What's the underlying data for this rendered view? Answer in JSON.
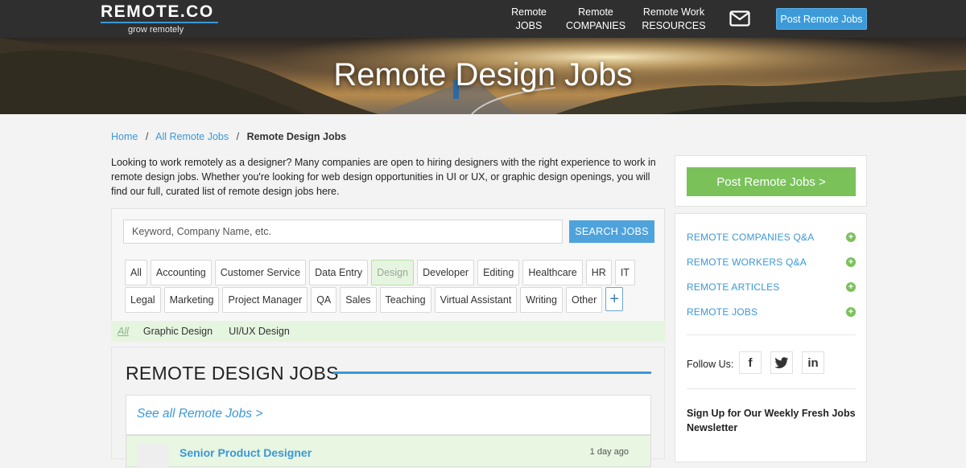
{
  "header": {
    "logo": "REMOTE.CO",
    "tagline": "grow remotely",
    "nav": [
      {
        "line1": "Remote",
        "line2": "JOBS"
      },
      {
        "line1": "Remote",
        "line2": "COMPANIES"
      },
      {
        "line1": "Remote Work",
        "line2": "RESOURCES"
      }
    ],
    "mail_icon": "mail-icon",
    "post_button": "Post Remote Jobs"
  },
  "hero": {
    "title": "Remote Design Jobs"
  },
  "breadcrumb": {
    "home": "Home",
    "sep1": "/",
    "all_jobs": "All Remote Jobs",
    "sep2": "/",
    "current": "Remote Design Jobs"
  },
  "intro": "Looking to work remotely as a designer? Many companies are open to hiring designers with the right experience to work in remote design jobs. Whether you're looking for web design opportunities in UI or UX, or graphic design openings, you will find our full, curated list of remote design jobs here.",
  "search": {
    "placeholder": "Keyword, Company Name, etc.",
    "button": "SEARCH JOBS"
  },
  "categories_row1": [
    "All",
    "Accounting",
    "Customer Service",
    "Data Entry",
    "Design",
    "Developer",
    "Editing",
    "Healthcare",
    "HR",
    "IT"
  ],
  "categories_row2": [
    "Legal",
    "Marketing",
    "Project Manager",
    "QA",
    "Sales",
    "Teaching",
    "Virtual Assistant",
    "Writing",
    "Other"
  ],
  "active_category": "Design",
  "more_button": "+",
  "subcategories": {
    "all": "All",
    "items": [
      "Graphic Design",
      "UI/UX Design"
    ]
  },
  "jobs": {
    "heading": "REMOTE DESIGN JOBS",
    "see_all": "See all Remote Jobs >",
    "first_job_title": "Senior Product Designer",
    "first_job_date": "1 day ago"
  },
  "sidebar": {
    "post_button": "Post Remote Jobs >",
    "links": [
      "REMOTE COMPANIES Q&A",
      "REMOTE WORKERS Q&A",
      "REMOTE ARTICLES",
      "REMOTE JOBS"
    ],
    "follow_label": "Follow Us:",
    "social": [
      {
        "icon": "facebook-icon",
        "glyph": "f"
      },
      {
        "icon": "twitter-icon",
        "glyph": "t"
      },
      {
        "icon": "linkedin-icon",
        "glyph": "in"
      }
    ],
    "newsletter": "Sign Up for Our Weekly Fresh Jobs Newsletter"
  },
  "colors": {
    "accent": "#3a98d8",
    "green": "#7ac15a",
    "topbar": "#2f2f2f"
  }
}
